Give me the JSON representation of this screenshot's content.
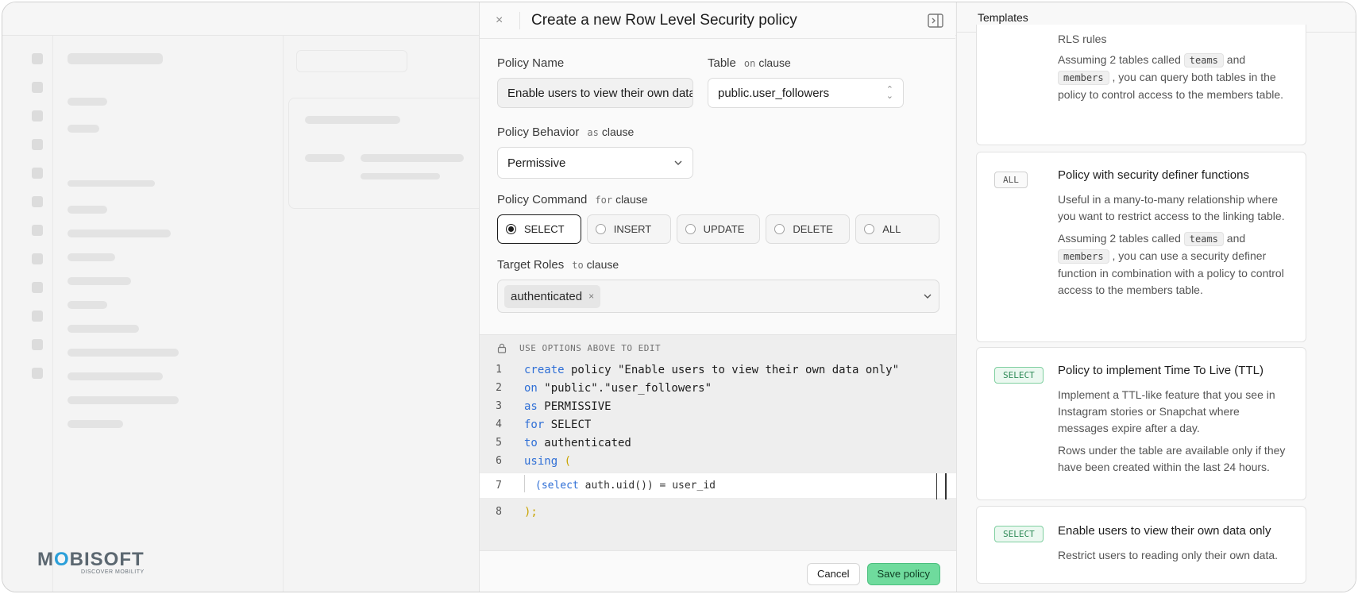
{
  "panel": {
    "title": "Create a new Row Level Security policy",
    "close_glyph": "×"
  },
  "form": {
    "policy_name": {
      "label": "Policy Name",
      "value": "Enable users to view their own data only"
    },
    "table": {
      "label": "Table",
      "clause_code": "on",
      "clause_word": "clause",
      "value": "public.user_followers"
    },
    "behavior": {
      "label": "Policy Behavior",
      "clause_code": "as",
      "clause_word": "clause",
      "value": "Permissive"
    },
    "command": {
      "label": "Policy Command",
      "clause_code": "for",
      "clause_word": "clause",
      "options": [
        "SELECT",
        "INSERT",
        "UPDATE",
        "DELETE",
        "ALL"
      ],
      "selected": "SELECT"
    },
    "roles": {
      "label": "Target Roles",
      "clause_code": "to",
      "clause_word": "clause",
      "chips": [
        "authenticated"
      ],
      "remove_glyph": "×"
    }
  },
  "code": {
    "note": "USE OPTIONS ABOVE TO EDIT",
    "lines": [
      {
        "num": "1",
        "kw": "create",
        "rest": " policy \"Enable users to view their own data only\""
      },
      {
        "num": "2",
        "kw": "on",
        "rest": " \"public\".\"user_followers\""
      },
      {
        "num": "3",
        "kw": "as",
        "rest": " PERMISSIVE"
      },
      {
        "num": "4",
        "kw": "for",
        "rest": " SELECT"
      },
      {
        "num": "5",
        "kw": "to",
        "rest": " authenticated"
      },
      {
        "num": "6",
        "kw": "using",
        "rest": " ("
      }
    ],
    "line7": {
      "num": "7",
      "kw": "(select",
      "rest": " auth.uid()) = user_id"
    },
    "line8": {
      "num": "8",
      "text": ");"
    }
  },
  "footer": {
    "cancel_label": "Cancel",
    "save_label": "Save policy"
  },
  "templates": {
    "tab_label": "Templates",
    "cards": [
      {
        "title": "RLS rules",
        "paragraphs": [
          {
            "pre": "Assuming 2 tables called ",
            "code1": "teams",
            "mid": " and ",
            "code2": "members",
            "post": " , you can query both tables in the policy to control access to the members table."
          }
        ]
      },
      {
        "badge": "ALL",
        "title": "Policy with security definer functions",
        "p1": "Useful in a many-to-many relationship where you want to restrict access to the linking table.",
        "p2": {
          "pre": "Assuming 2 tables called ",
          "code1": "teams",
          "mid": " and ",
          "code2": "members",
          "post": " , you can use a security definer function in combination with a policy to control access to the members table."
        }
      },
      {
        "badge": "SELECT",
        "title": "Policy to implement Time To Live (TTL)",
        "p1": "Implement a TTL-like feature that you see in Instagram stories or Snapchat where messages expire after a day.",
        "p2": "Rows under the table are available only if they have been created within the last 24 hours."
      },
      {
        "badge": "SELECT",
        "title": "Enable users to view their own data only",
        "p1": "Restrict users to reading only their own data."
      }
    ]
  },
  "branding": {
    "logo_text_pre": "M",
    "logo_text_o": "O",
    "logo_text_post": "BISOFT",
    "tagline": "DISCOVER MOBILITY"
  },
  "colors": {
    "keyword": "#2f6fd6",
    "save_button": "#6fdb9d",
    "select_badge": "#2f8a57",
    "accent_blue": "#2b9fd9"
  },
  "icons": [
    "close-icon",
    "sidebar-toggle-icon",
    "stepper-icon",
    "chevron-down-icon",
    "lock-icon",
    "remove-chip-icon"
  ]
}
